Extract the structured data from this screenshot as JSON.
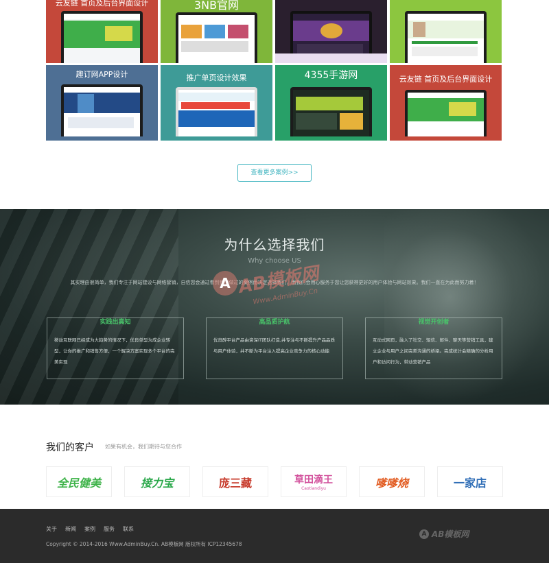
{
  "portfolio": {
    "tiles": [
      {
        "title": "云友链 首页及后台界面设计",
        "subtitle": "",
        "bg": "#c4483a",
        "accent": "#3fae4a"
      },
      {
        "title": "3NB官网",
        "subtitle": "",
        "bg": "#7fb63a",
        "accent": "#e9a23b"
      },
      {
        "title": "",
        "subtitle": "",
        "bg": "#2a1f2e",
        "accent": "#6a3c8c"
      },
      {
        "title": "",
        "subtitle": "",
        "bg": "#8cc63f",
        "accent": "#2f9a3e"
      },
      {
        "title": "趣订网APP设计",
        "subtitle": "",
        "bg": "#4e6f94",
        "accent": "#234a86"
      },
      {
        "title": "推广单页设计效果",
        "subtitle": "",
        "bg": "#3e9b97",
        "accent": "#e8483b"
      },
      {
        "title": "4355手游网",
        "subtitle": "",
        "bg": "#28a068",
        "accent": "#a5c93a"
      },
      {
        "title": "云友链 首页及后台界面设计",
        "subtitle": "",
        "bg": "#c4483a",
        "accent": "#3fae4a"
      }
    ],
    "more_label": "查看更多案例>>"
  },
  "why": {
    "title": "为什么选择我们",
    "subtitle": "Why choose US",
    "description": "其实理由很简单，我们专注于网站建设与网络营销，自信您会通过看到我们做过的案例而决定选择我们，而我们会用心服务于您让您获得更好的用户体验与网站效果。我们一直在为此而努力着！",
    "features": [
      {
        "title": "实践出真知",
        "body": "移动互联网已经成为大趋势的情况下，优良单型为成企业转型，让你的推广和销售方便，一个解决方案实现多个平台的完美实现"
      },
      {
        "title": "高品质护航",
        "body": "优良醉平台产品由资深IT团队打造,并专注与不断提升产品品质与用户体验，并不断为平台注入提高企业竞争力的核心动能"
      },
      {
        "title": "视觉开创者",
        "body": "互动式网页，融入了社交、短信、邮件、聊天等营销工具，建立企业与用户之间完美沟通的桥梁。完成统计会精确的分析用户和访问行为，带动营销产品"
      }
    ]
  },
  "watermark": {
    "name": "AB模板网",
    "url": "Www.AdminBuy.Cn"
  },
  "clients": {
    "title": "我们的客户",
    "subtitle": "如果有机会，我们期待与您合作",
    "logos": [
      {
        "text": "全民健美",
        "color": "#3fb34a"
      },
      {
        "text": "接力宝",
        "color": "#2aa84a"
      },
      {
        "text": "庞三藏",
        "color": "#c73a2b"
      },
      {
        "text": "草田滴王",
        "color": "#d24f9b",
        "subtext": "Caotiandiyu"
      },
      {
        "text": "嗲嗲烧",
        "color": "#e25d23"
      },
      {
        "text": "一家店",
        "color": "#2e6db6"
      }
    ]
  },
  "footer": {
    "nav": [
      "关于",
      "新闻",
      "案例",
      "服务",
      "联系"
    ],
    "copyright": "Copyright © 2014-2016 Www.AdminBuy.Cn. AB模板网 版权所有 ICP12345678",
    "logo_text": "AB模板网"
  }
}
